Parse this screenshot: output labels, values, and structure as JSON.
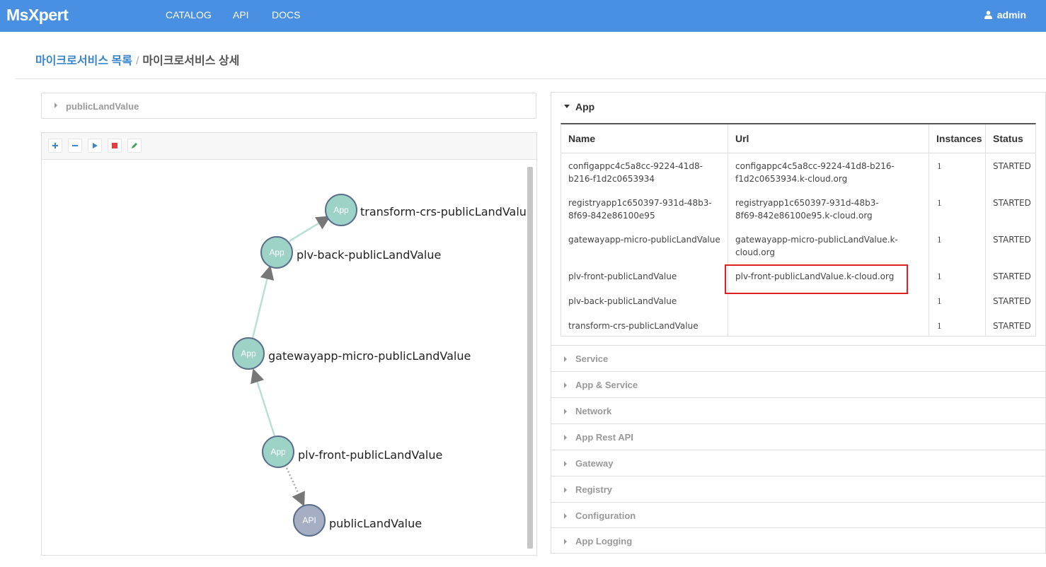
{
  "brand": {
    "logo_text": "MsXpert"
  },
  "nav": {
    "items": [
      "CATALOG",
      "API",
      "DOCS"
    ]
  },
  "user": {
    "name": "admin",
    "icon": "user-icon"
  },
  "breadcrumb": {
    "parent": "마이크로서비스 목록",
    "separator": "/",
    "current": "마이크로서비스 상세"
  },
  "left": {
    "collapse_label": "publicLandValue",
    "toolbar": [
      {
        "name": "zoom-in-button",
        "icon": "plus-icon",
        "color": "#3a86c8"
      },
      {
        "name": "zoom-out-button",
        "icon": "minus-icon",
        "color": "#3a86c8"
      },
      {
        "name": "play-button",
        "icon": "play-icon",
        "color": "#3a86c8"
      },
      {
        "name": "stop-button",
        "icon": "stop-icon",
        "color": "#e04040"
      },
      {
        "name": "edit-button",
        "icon": "pencil-icon",
        "color": "#3aa35a"
      }
    ],
    "graph": {
      "nodes": [
        {
          "id": "transform",
          "type": "App",
          "label": "transform-crs-publicLandValue"
        },
        {
          "id": "back",
          "type": "App",
          "label": "plv-back-publicLandValue"
        },
        {
          "id": "gateway",
          "type": "App",
          "label": "gatewayapp-micro-publicLandValue"
        },
        {
          "id": "front",
          "type": "App",
          "label": "plv-front-publicLandValue"
        },
        {
          "id": "api",
          "type": "API",
          "label": "publicLandValue"
        }
      ],
      "colors": {
        "app_fill": "#9dd3c6",
        "api_fill": "#a5aec2",
        "node_stroke": "#5a6e8c",
        "edge": "#b8e0d6",
        "dotted_edge": "#aaaaaa"
      }
    }
  },
  "right": {
    "app_section_label": "App",
    "table": {
      "headers": [
        "Name",
        "Url",
        "Instances",
        "Status"
      ],
      "rows": [
        {
          "name": "configappc4c5a8cc-9224-41d8-b216-f1d2c0653934",
          "url": "configappc4c5a8cc-9224-41d8-b216-f1d2c0653934.k-cloud.org",
          "instances": "1",
          "status": "STARTED"
        },
        {
          "name": "registryapp1c650397-931d-48b3-8f69-842e86100e95",
          "url": "registryapp1c650397-931d-48b3-8f69-842e86100e95.k-cloud.org",
          "instances": "1",
          "status": "STARTED"
        },
        {
          "name": "gatewayapp-micro-publicLandValue",
          "url": "gatewayapp-micro-publicLandValue.k-cloud.org",
          "instances": "1",
          "status": "STARTED"
        },
        {
          "name": "plv-front-publicLandValue",
          "url": "plv-front-publicLandValue.k-cloud.org",
          "instances": "1",
          "status": "STARTED"
        },
        {
          "name": "plv-back-publicLandValue",
          "url": "",
          "instances": "1",
          "status": "STARTED"
        },
        {
          "name": "transform-crs-publicLandValue",
          "url": "",
          "instances": "1",
          "status": "STARTED"
        }
      ]
    },
    "accordion": [
      "Service",
      "App & Service",
      "Network",
      "App Rest API",
      "Gateway",
      "Registry",
      "Configuration",
      "App Logging"
    ]
  }
}
